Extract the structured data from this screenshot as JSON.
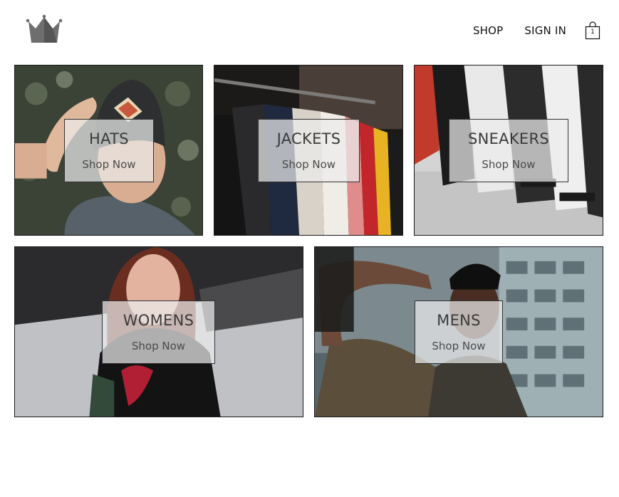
{
  "header": {
    "logo": "crown-logo",
    "nav": {
      "shop": "SHOP",
      "sign_in": "SIGN IN"
    },
    "cart": {
      "icon": "shopping-bag-icon",
      "count": "1"
    }
  },
  "directory": [
    {
      "key": "hats",
      "title": "HATS",
      "subtitle": "Shop Now"
    },
    {
      "key": "jackets",
      "title": "JACKETS",
      "subtitle": "Shop Now"
    },
    {
      "key": "sneakers",
      "title": "SNEAKERS",
      "subtitle": "Shop Now"
    },
    {
      "key": "womens",
      "title": "WOMENS",
      "subtitle": "Shop Now"
    },
    {
      "key": "mens",
      "title": "MENS",
      "subtitle": "Shop Now"
    }
  ],
  "colors": {
    "logo": "#555555",
    "border": "#1a1a1a",
    "text": "#111111"
  }
}
